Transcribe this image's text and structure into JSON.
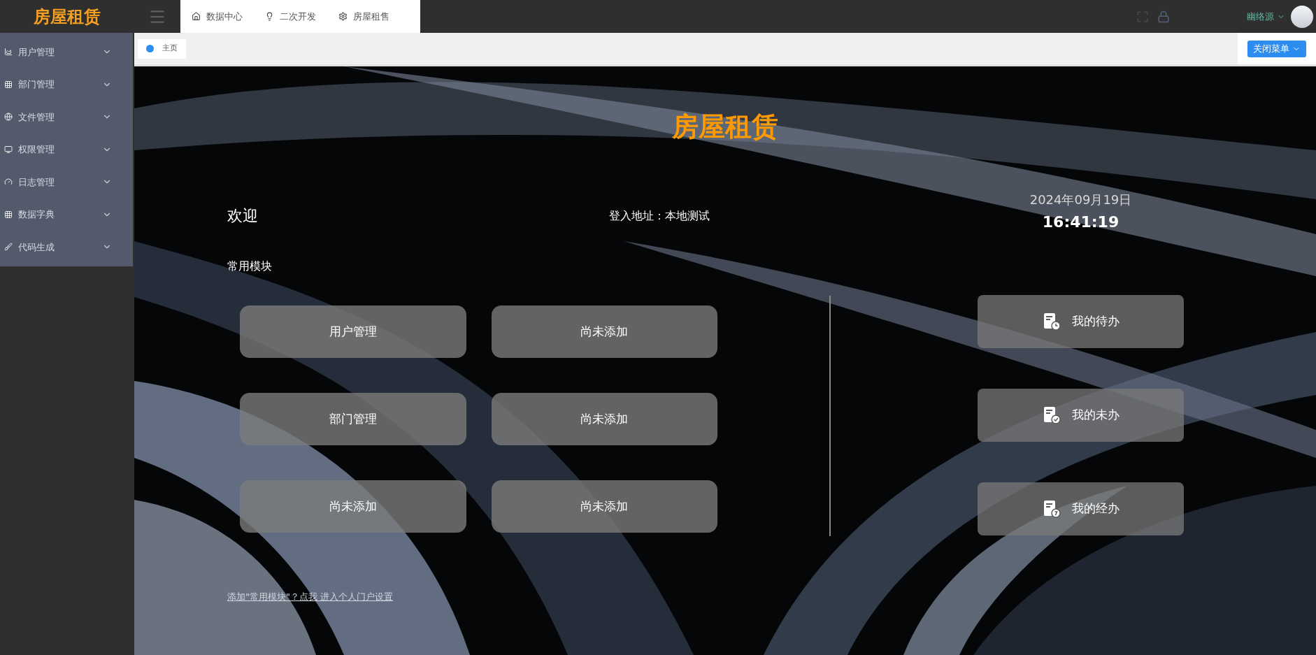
{
  "logo": "房屋租赁",
  "top_tabs": [
    {
      "label": "数据中心"
    },
    {
      "label": "二次开发"
    },
    {
      "label": "房屋租售"
    }
  ],
  "user": {
    "name": "幽络源"
  },
  "page_tabs": [
    {
      "label": "主页",
      "selected": true
    }
  ],
  "close_menu_button": "关闭菜单",
  "sidebar": {
    "items": [
      {
        "label": "用户管理",
        "expanded": false
      },
      {
        "label": "部门管理",
        "expanded": false
      },
      {
        "label": "文件管理",
        "expanded": false
      },
      {
        "label": "权限管理",
        "expanded": false
      },
      {
        "label": "日志管理",
        "expanded": false
      },
      {
        "label": "数据字典",
        "expanded": false
      },
      {
        "label": "代码生成",
        "expanded": false
      }
    ]
  },
  "home": {
    "title": "房屋租赁",
    "welcome": "欢迎",
    "login_address": "登入地址：本地测试",
    "date": "2024年09月19日",
    "time": "16:41:19",
    "section_title": "常用模块",
    "modules": [
      "用户管理",
      "尚未添加",
      "部门管理",
      "尚未添加",
      "尚未添加",
      "尚未添加"
    ],
    "tasks": [
      {
        "label": "我的待办"
      },
      {
        "label": "我的未办"
      },
      {
        "label": "我的经办"
      }
    ],
    "settings_link": "添加\"常用模块\"？点我 进入个人门户设置"
  }
}
